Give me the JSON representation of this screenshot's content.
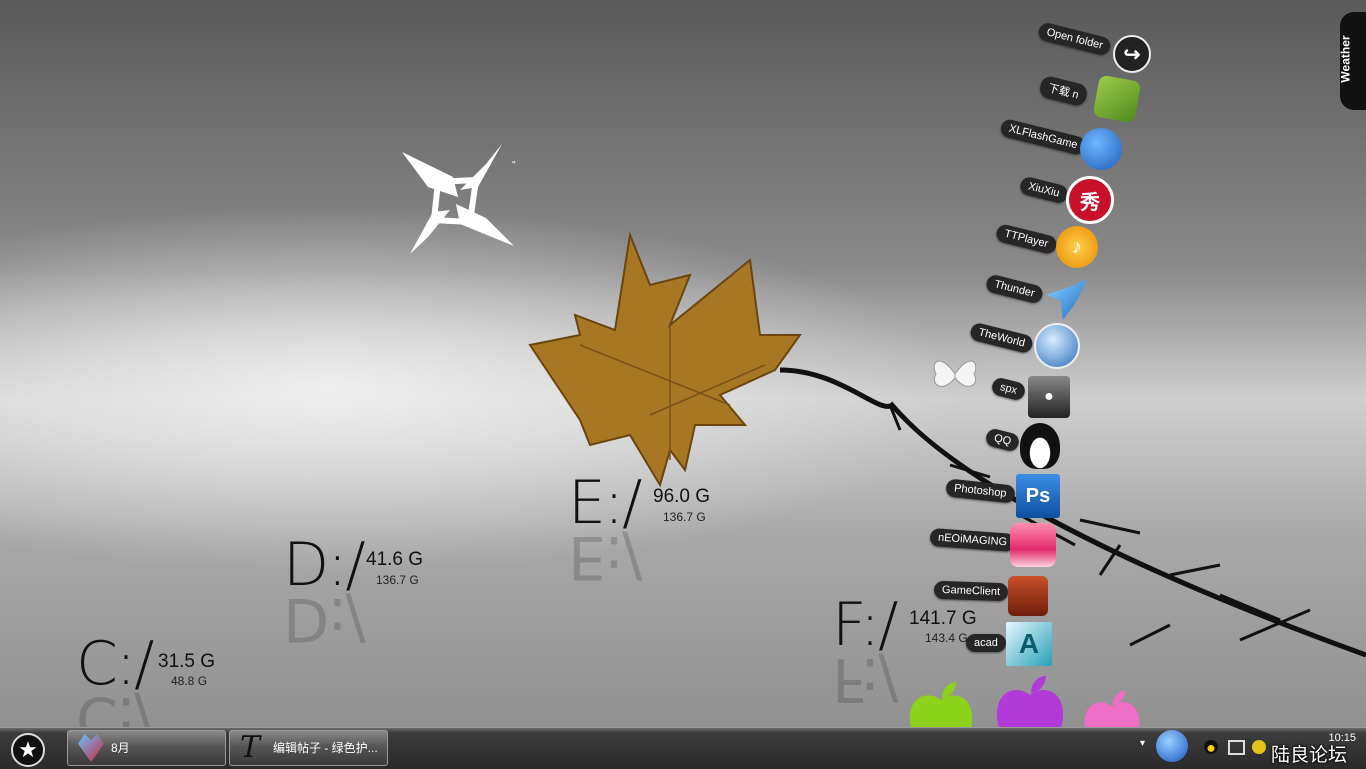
{
  "desktop": {
    "drives": [
      {
        "letter": "C:/",
        "free": "31.5 G",
        "total": "48.8 G"
      },
      {
        "letter": "D:/",
        "free": "41.6 G",
        "total": "136.7 G"
      },
      {
        "letter": "E:/",
        "free": "96.0 G",
        "total": "136.7 G"
      },
      {
        "letter": "F:/",
        "free": "141.7 G",
        "total": "143.4 G"
      }
    ],
    "logo_mark": "\""
  },
  "dock": {
    "items": [
      {
        "label": "Open folder",
        "icon": "arrow-circle-icon"
      },
      {
        "label": "下载  n",
        "icon": "green-folder-icon"
      },
      {
        "label": "XLFlashGame",
        "icon": "blue-bird-icon"
      },
      {
        "label": "XiuXiu",
        "icon": "xiuxiu-icon",
        "glyph": "秀"
      },
      {
        "label": "TTPlayer",
        "icon": "headphones-icon"
      },
      {
        "label": "Thunder",
        "icon": "hummingbird-icon"
      },
      {
        "label": "TheWorld",
        "icon": "globe-icon"
      },
      {
        "label": "spx",
        "icon": "camcorder-icon"
      },
      {
        "label": "QQ",
        "icon": "penguin-icon"
      },
      {
        "label": "Photoshop",
        "icon": "photoshop-icon",
        "glyph": "Ps"
      },
      {
        "label": "nEOiMAGING",
        "icon": "neoimaging-icon"
      },
      {
        "label": "GameClient",
        "icon": "game-client-icon"
      },
      {
        "label": "acad",
        "icon": "autocad-icon",
        "glyph": "A"
      }
    ]
  },
  "weather": {
    "label": "Weather"
  },
  "taskbar": {
    "tasks": [
      {
        "label": "8月",
        "icon": "heart-crystal-icon"
      },
      {
        "label": "编辑帖子 - 绿色护...",
        "icon": "typography-t-icon"
      }
    ],
    "clock": "10:15"
  },
  "watermark": "陆良论坛",
  "colors": {
    "accent_apple_green": "#8dd21a",
    "accent_apple_purple": "#b23ad9",
    "accent_apple_pink": "#ef6ec6"
  }
}
